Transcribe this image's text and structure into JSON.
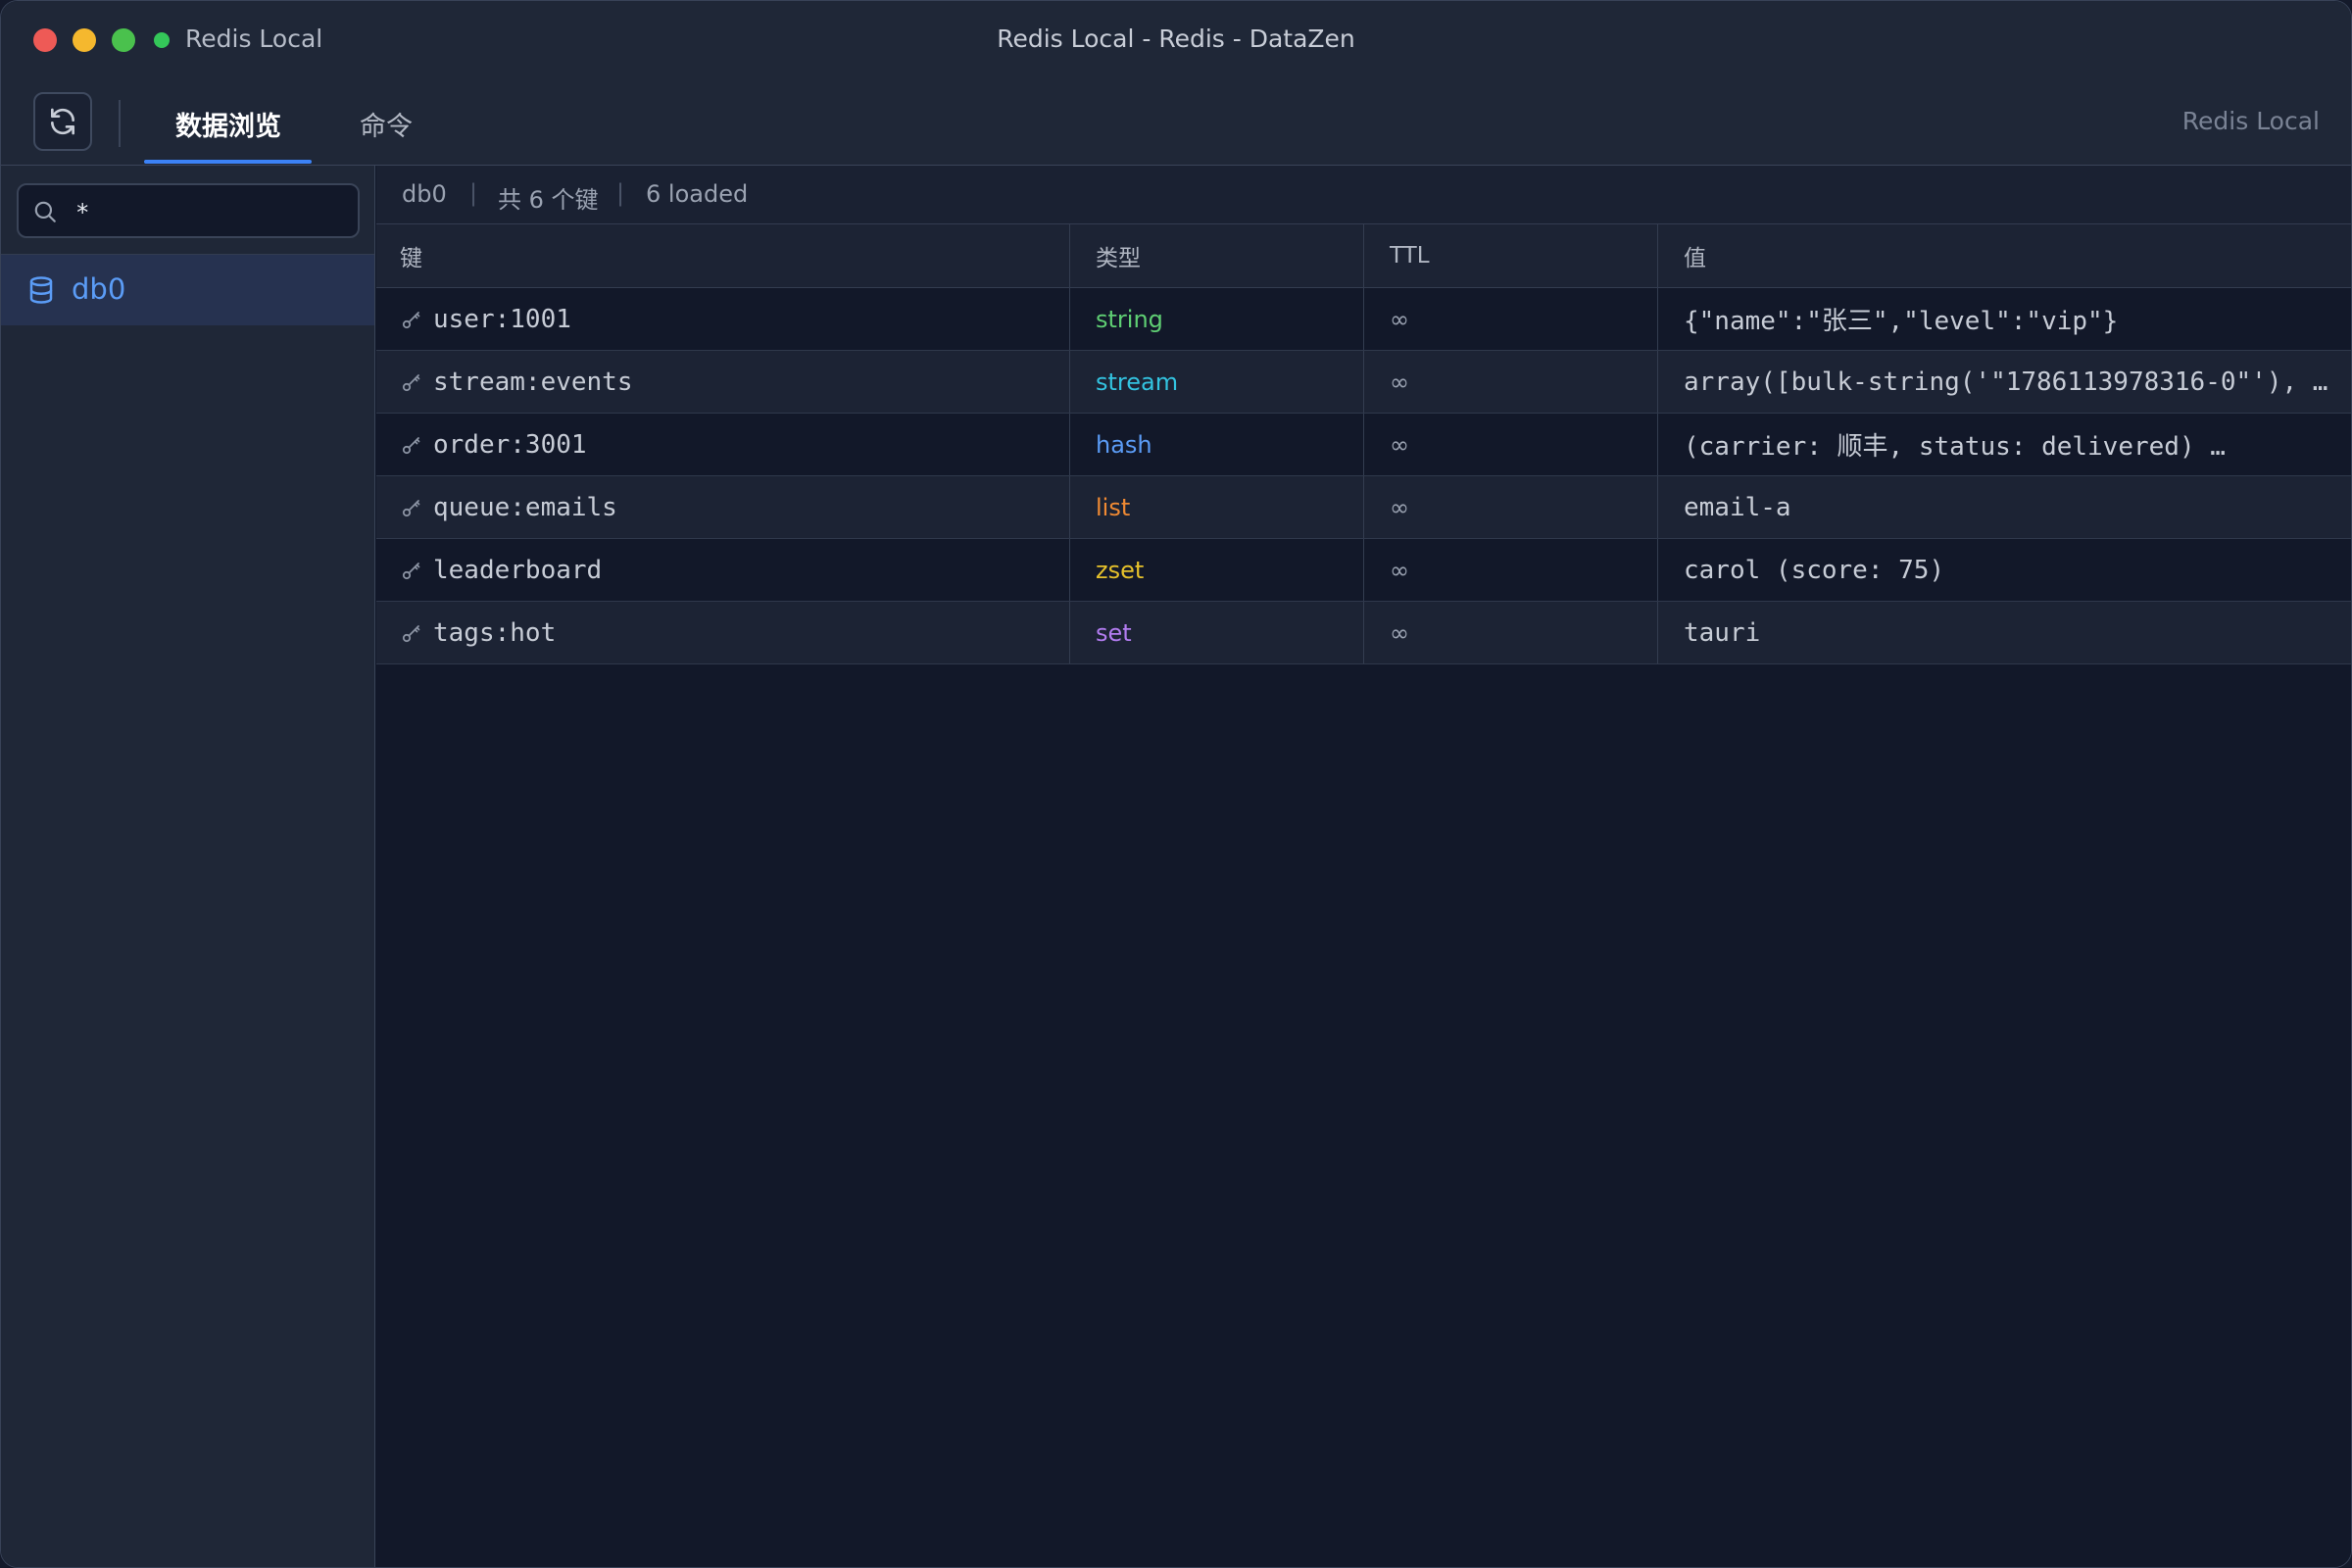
{
  "window": {
    "connection_name": "Redis Local",
    "title": "Redis Local - Redis - DataZen"
  },
  "toolbar": {
    "tabs": [
      {
        "label": "数据浏览",
        "active": true
      },
      {
        "label": "命令",
        "active": false
      }
    ],
    "connection_label": "Redis Local",
    "icons": {
      "refresh": "refresh-icon"
    }
  },
  "sidebar": {
    "search_value": "*",
    "databases": [
      {
        "label": "db0",
        "selected": true
      }
    ]
  },
  "status": {
    "db": "db0",
    "key_count": "共 6 个键",
    "loaded": "6 loaded"
  },
  "table": {
    "columns": {
      "key": "键",
      "type": "类型",
      "ttl": "TTL",
      "value": "值"
    },
    "rows": [
      {
        "key": "user:1001",
        "type": "string",
        "ttl": "∞",
        "value": "{\"name\":\"张三\",\"level\":\"vip\"}"
      },
      {
        "key": "stream:events",
        "type": "stream",
        "ttl": "∞",
        "value": "array([bulk-string('\"1786113978316-0\"'), …"
      },
      {
        "key": "order:3001",
        "type": "hash",
        "ttl": "∞",
        "value": "(carrier: 顺丰, status: delivered) …"
      },
      {
        "key": "queue:emails",
        "type": "list",
        "ttl": "∞",
        "value": "email-a"
      },
      {
        "key": "leaderboard",
        "type": "zset",
        "ttl": "∞",
        "value": "carol (score: 75)"
      },
      {
        "key": "tags:hot",
        "type": "set",
        "ttl": "∞",
        "value": "tauri"
      }
    ]
  },
  "type_colors": {
    "string": "#5fcf73",
    "stream": "#33c3e0",
    "hash": "#5b9cf6",
    "list": "#f08a33",
    "zset": "#e6c12b",
    "set": "#b27cf0"
  },
  "colors": {
    "accent": "#3c82f6",
    "connected": "#34c759"
  }
}
